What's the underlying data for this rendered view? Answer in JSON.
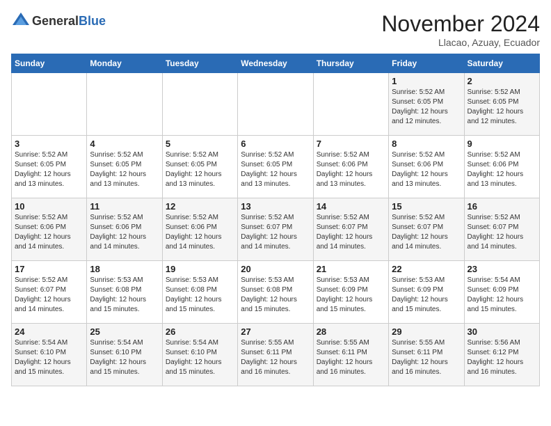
{
  "header": {
    "logo_general": "General",
    "logo_blue": "Blue",
    "month_title": "November 2024",
    "location": "Llacao, Azuay, Ecuador"
  },
  "calendar": {
    "days_of_week": [
      "Sunday",
      "Monday",
      "Tuesday",
      "Wednesday",
      "Thursday",
      "Friday",
      "Saturday"
    ],
    "weeks": [
      [
        {
          "day": "",
          "info": ""
        },
        {
          "day": "",
          "info": ""
        },
        {
          "day": "",
          "info": ""
        },
        {
          "day": "",
          "info": ""
        },
        {
          "day": "",
          "info": ""
        },
        {
          "day": "1",
          "info": "Sunrise: 5:52 AM\nSunset: 6:05 PM\nDaylight: 12 hours\nand 12 minutes."
        },
        {
          "day": "2",
          "info": "Sunrise: 5:52 AM\nSunset: 6:05 PM\nDaylight: 12 hours\nand 12 minutes."
        }
      ],
      [
        {
          "day": "3",
          "info": "Sunrise: 5:52 AM\nSunset: 6:05 PM\nDaylight: 12 hours\nand 13 minutes."
        },
        {
          "day": "4",
          "info": "Sunrise: 5:52 AM\nSunset: 6:05 PM\nDaylight: 12 hours\nand 13 minutes."
        },
        {
          "day": "5",
          "info": "Sunrise: 5:52 AM\nSunset: 6:05 PM\nDaylight: 12 hours\nand 13 minutes."
        },
        {
          "day": "6",
          "info": "Sunrise: 5:52 AM\nSunset: 6:05 PM\nDaylight: 12 hours\nand 13 minutes."
        },
        {
          "day": "7",
          "info": "Sunrise: 5:52 AM\nSunset: 6:06 PM\nDaylight: 12 hours\nand 13 minutes."
        },
        {
          "day": "8",
          "info": "Sunrise: 5:52 AM\nSunset: 6:06 PM\nDaylight: 12 hours\nand 13 minutes."
        },
        {
          "day": "9",
          "info": "Sunrise: 5:52 AM\nSunset: 6:06 PM\nDaylight: 12 hours\nand 13 minutes."
        }
      ],
      [
        {
          "day": "10",
          "info": "Sunrise: 5:52 AM\nSunset: 6:06 PM\nDaylight: 12 hours\nand 14 minutes."
        },
        {
          "day": "11",
          "info": "Sunrise: 5:52 AM\nSunset: 6:06 PM\nDaylight: 12 hours\nand 14 minutes."
        },
        {
          "day": "12",
          "info": "Sunrise: 5:52 AM\nSunset: 6:06 PM\nDaylight: 12 hours\nand 14 minutes."
        },
        {
          "day": "13",
          "info": "Sunrise: 5:52 AM\nSunset: 6:07 PM\nDaylight: 12 hours\nand 14 minutes."
        },
        {
          "day": "14",
          "info": "Sunrise: 5:52 AM\nSunset: 6:07 PM\nDaylight: 12 hours\nand 14 minutes."
        },
        {
          "day": "15",
          "info": "Sunrise: 5:52 AM\nSunset: 6:07 PM\nDaylight: 12 hours\nand 14 minutes."
        },
        {
          "day": "16",
          "info": "Sunrise: 5:52 AM\nSunset: 6:07 PM\nDaylight: 12 hours\nand 14 minutes."
        }
      ],
      [
        {
          "day": "17",
          "info": "Sunrise: 5:52 AM\nSunset: 6:07 PM\nDaylight: 12 hours\nand 14 minutes."
        },
        {
          "day": "18",
          "info": "Sunrise: 5:53 AM\nSunset: 6:08 PM\nDaylight: 12 hours\nand 15 minutes."
        },
        {
          "day": "19",
          "info": "Sunrise: 5:53 AM\nSunset: 6:08 PM\nDaylight: 12 hours\nand 15 minutes."
        },
        {
          "day": "20",
          "info": "Sunrise: 5:53 AM\nSunset: 6:08 PM\nDaylight: 12 hours\nand 15 minutes."
        },
        {
          "day": "21",
          "info": "Sunrise: 5:53 AM\nSunset: 6:09 PM\nDaylight: 12 hours\nand 15 minutes."
        },
        {
          "day": "22",
          "info": "Sunrise: 5:53 AM\nSunset: 6:09 PM\nDaylight: 12 hours\nand 15 minutes."
        },
        {
          "day": "23",
          "info": "Sunrise: 5:54 AM\nSunset: 6:09 PM\nDaylight: 12 hours\nand 15 minutes."
        }
      ],
      [
        {
          "day": "24",
          "info": "Sunrise: 5:54 AM\nSunset: 6:10 PM\nDaylight: 12 hours\nand 15 minutes."
        },
        {
          "day": "25",
          "info": "Sunrise: 5:54 AM\nSunset: 6:10 PM\nDaylight: 12 hours\nand 15 minutes."
        },
        {
          "day": "26",
          "info": "Sunrise: 5:54 AM\nSunset: 6:10 PM\nDaylight: 12 hours\nand 15 minutes."
        },
        {
          "day": "27",
          "info": "Sunrise: 5:55 AM\nSunset: 6:11 PM\nDaylight: 12 hours\nand 16 minutes."
        },
        {
          "day": "28",
          "info": "Sunrise: 5:55 AM\nSunset: 6:11 PM\nDaylight: 12 hours\nand 16 minutes."
        },
        {
          "day": "29",
          "info": "Sunrise: 5:55 AM\nSunset: 6:11 PM\nDaylight: 12 hours\nand 16 minutes."
        },
        {
          "day": "30",
          "info": "Sunrise: 5:56 AM\nSunset: 6:12 PM\nDaylight: 12 hours\nand 16 minutes."
        }
      ]
    ]
  }
}
